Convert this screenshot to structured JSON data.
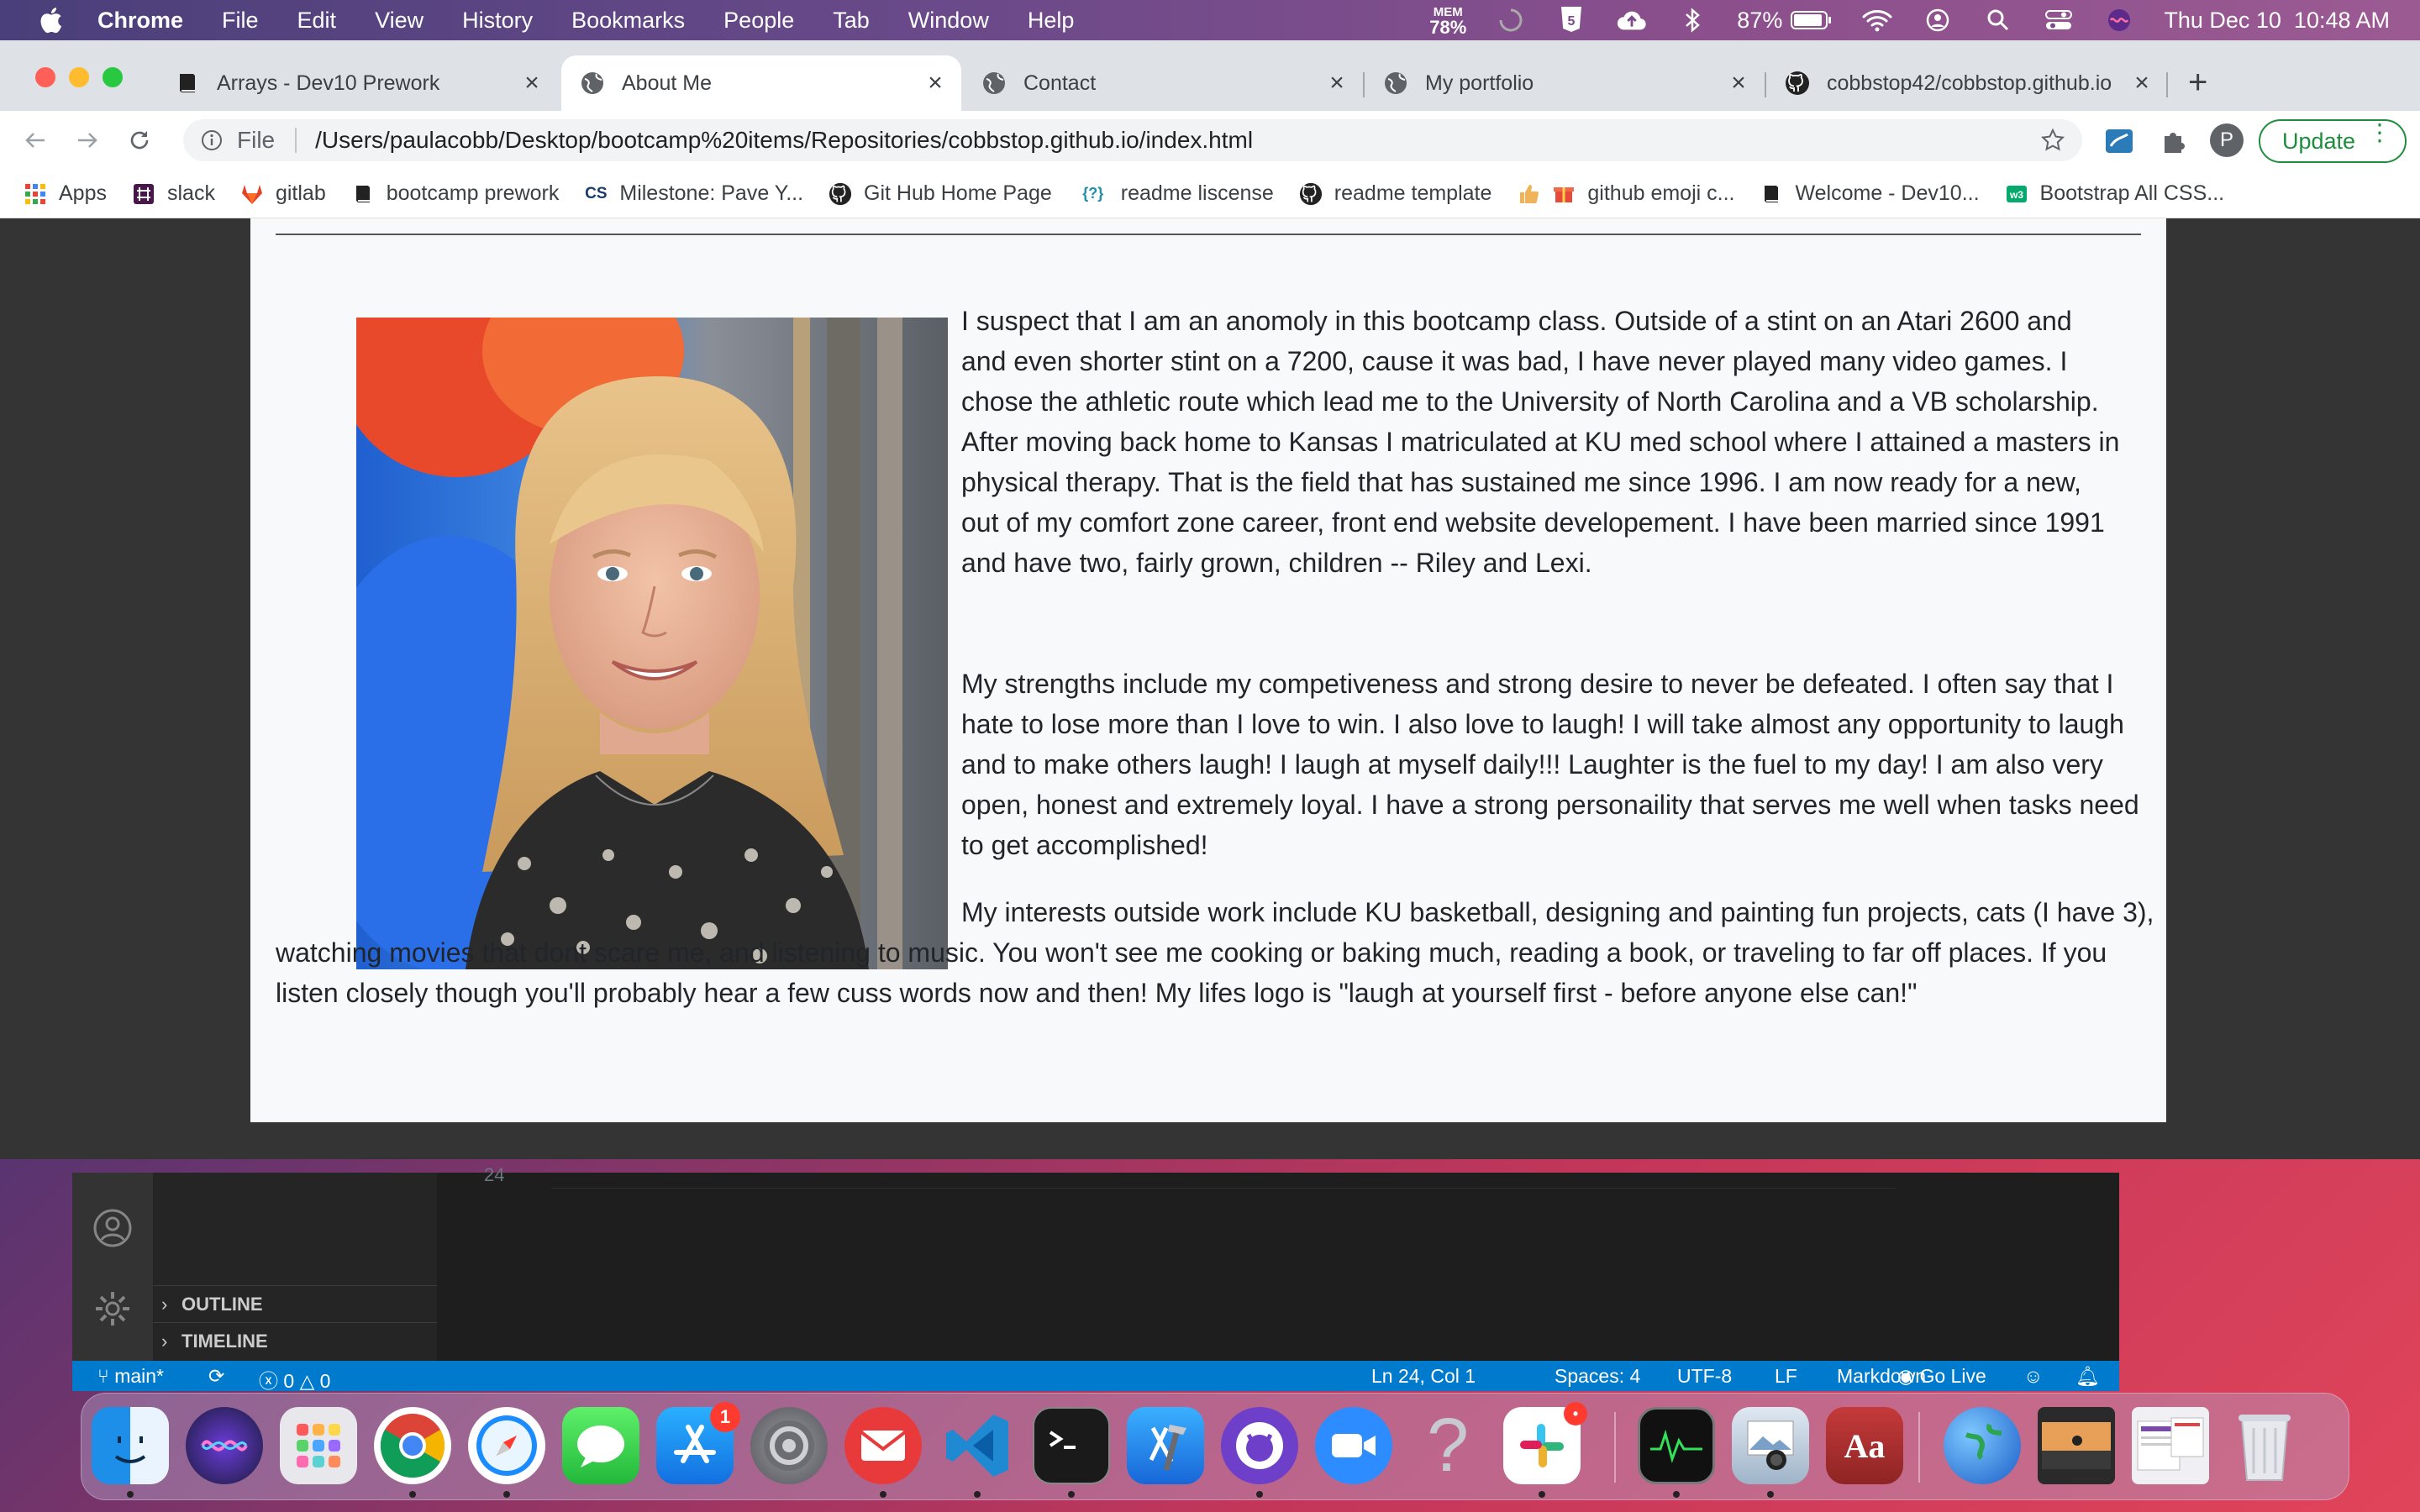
{
  "menubar": {
    "app_name": "Chrome",
    "menus": [
      "File",
      "Edit",
      "View",
      "History",
      "Bookmarks",
      "People",
      "Tab",
      "Window",
      "Help"
    ],
    "mem_label": "MEM",
    "mem_value": "78%",
    "battery": "87%",
    "datetime": "Thu Dec 10  10:48 AM"
  },
  "tabs": [
    {
      "title": "Arrays - Dev10 Prework",
      "icon": "book-icon",
      "active": false
    },
    {
      "title": "About Me",
      "icon": "globe-icon",
      "active": true
    },
    {
      "title": "Contact",
      "icon": "globe-icon",
      "active": false
    },
    {
      "title": "My portfolio",
      "icon": "globe-icon",
      "active": false
    },
    {
      "title": "cobbstop42/cobbstop.github.io",
      "icon": "github-icon",
      "active": false
    }
  ],
  "omnibox": {
    "scheme": "File",
    "url": "/Users/paulacobb/Desktop/bootcamp%20items/Repositories/cobbstop.github.io/index.html"
  },
  "profile_initial": "P",
  "update_label": "Update",
  "bookmarks": [
    {
      "label": "Apps",
      "icon": "apps-grid-icon"
    },
    {
      "label": "slack",
      "icon": "slack-icon"
    },
    {
      "label": "gitlab",
      "icon": "gitlab-icon"
    },
    {
      "label": "bootcamp prework",
      "icon": "book-icon"
    },
    {
      "label": "Milestone: Pave Y...",
      "icon": "cs-icon"
    },
    {
      "label": "Git Hub Home Page",
      "icon": "github-icon"
    },
    {
      "label": "readme liscense",
      "icon": "question-icon"
    },
    {
      "label": "readme template",
      "icon": "github-icon"
    },
    {
      "label": "github emoji c...",
      "icon": "emoji-icon"
    },
    {
      "label": "Welcome - Dev10...",
      "icon": "book-icon"
    },
    {
      "label": "Bootstrap All CSS...",
      "icon": "w3-icon"
    }
  ],
  "bookmark_icon_text": {
    "cs": "CS",
    "question": "{?}"
  },
  "page": {
    "paragraphs": [
      "I suspect that I am an anomoly in this bootcamp class. Outside of a stint on an Atari 2600 and and even shorter stint on a 7200, cause it was bad, I have never played many video games. I chose the athletic route which lead me to the University of North Carolina and a VB scholarship. After moving back home to Kansas I matriculated at KU med school where I attained a masters in physical therapy. That is the field that has sustained me since 1996. I am now ready for a new, out of my comfort zone career, front end website developement. I have been married since 1991 and have two, fairly grown, children -- Riley and Lexi.",
      "My strengths include my competiveness and strong desire to never be defeated. I often say that I hate to lose more than I love to win. I also love to laugh! I will take almost any opportunity to laugh and to make others laugh! I laugh at myself daily!!! Laughter is the fuel to my day! I am also very open, honest and extremely loyal. I have a strong personaility that serves me well when tasks need to get accomplished!",
      "My interests outside work include KU basketball, designing and painting fun projects, cats (I have 3), watching movies that dont scare me, and listening to music. You won't see me cooking or baking much, reading a book, or traveling to far off places. If you listen closely though you'll probably hear a few cuss words now and then! My lifes logo is \"laugh at yourself first - before anyone else can!\""
    ]
  },
  "vscode": {
    "line_number": "24",
    "sidebar": [
      "OUTLINE",
      "TIMELINE"
    ],
    "status": {
      "branch": "main*",
      "errors": "0",
      "warnings": "0",
      "position": "Ln 24, Col 1",
      "spaces": "Spaces: 4",
      "encoding": "UTF-8",
      "eol": "LF",
      "language": "Markdown",
      "golive": "Go Live"
    }
  },
  "dock": {
    "appstore_badge": "1",
    "dictionary_label": "Aa",
    "help_glyph": "?"
  },
  "colors": {
    "chrome_update_green": "#1e8e3e",
    "vscode_statusbar": "#007acc",
    "window_border_teal": "#4aa7a0"
  }
}
